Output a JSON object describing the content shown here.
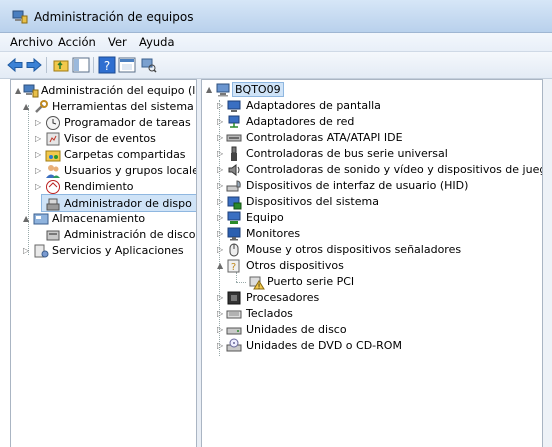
{
  "window": {
    "title": "Administración de equipos"
  },
  "menu": [
    "Archivo",
    "Acción",
    "Ver",
    "Ayuda"
  ],
  "toolbar": {
    "buttons": [
      "back-icon",
      "forward-icon",
      "up-folder-icon",
      "show-hide-tree-icon",
      "help-icon",
      "properties-icon",
      "scan-hardware-icon"
    ]
  },
  "left_tree": {
    "items": [
      {
        "label": "Administración del equipo (loc",
        "expand": "▲",
        "icon": "computer-management-icon",
        "level": 0
      },
      {
        "label": "Herramientas del sistema",
        "expand": "▲",
        "icon": "system-tools-icon",
        "level": 1
      },
      {
        "label": "Programador de tareas",
        "expand": "▷",
        "icon": "task-scheduler-icon",
        "level": 2
      },
      {
        "label": "Visor de eventos",
        "expand": "▷",
        "icon": "event-viewer-icon",
        "level": 2
      },
      {
        "label": "Carpetas compartidas",
        "expand": "▷",
        "icon": "shared-folders-icon",
        "level": 2
      },
      {
        "label": "Usuarios y grupos locale",
        "expand": "▷",
        "icon": "users-groups-icon",
        "level": 2
      },
      {
        "label": "Rendimiento",
        "expand": "▷",
        "icon": "performance-icon",
        "level": 2
      },
      {
        "label": "Administrador de dispo",
        "expand": "",
        "icon": "device-manager-icon",
        "level": 2,
        "selected": true
      },
      {
        "label": "Almacenamiento",
        "expand": "▲",
        "icon": "storage-icon",
        "level": 1
      },
      {
        "label": "Administración de disco",
        "expand": "",
        "icon": "disk-management-icon",
        "level": 2
      },
      {
        "label": "Servicios y Aplicaciones",
        "expand": "▷",
        "icon": "services-apps-icon",
        "level": 1
      }
    ]
  },
  "device_tree": {
    "root": {
      "label": "BQTO09",
      "expand": "▲",
      "icon": "computer-icon"
    },
    "items": [
      {
        "label": "Adaptadores de pantalla",
        "expand": "▷",
        "icon": "display-adapter-icon",
        "level": 1
      },
      {
        "label": "Adaptadores de red",
        "expand": "▷",
        "icon": "network-adapter-icon",
        "level": 1
      },
      {
        "label": "Controladoras ATA/ATAPI IDE",
        "expand": "▷",
        "icon": "ide-controller-icon",
        "level": 1
      },
      {
        "label": "Controladoras de bus serie universal",
        "expand": "▷",
        "icon": "usb-controller-icon",
        "level": 1
      },
      {
        "label": "Controladoras de sonido y vídeo y dispositivos de juego",
        "expand": "▷",
        "icon": "sound-controller-icon",
        "level": 1
      },
      {
        "label": "Dispositivos de interfaz de usuario (HID)",
        "expand": "▷",
        "icon": "hid-icon",
        "level": 1
      },
      {
        "label": "Dispositivos del sistema",
        "expand": "▷",
        "icon": "system-devices-icon",
        "level": 1
      },
      {
        "label": "Equipo",
        "expand": "▷",
        "icon": "computer-device-icon",
        "level": 1
      },
      {
        "label": "Monitores",
        "expand": "▷",
        "icon": "monitor-icon",
        "level": 1
      },
      {
        "label": "Mouse y otros dispositivos señaladores",
        "expand": "▷",
        "icon": "mouse-icon",
        "level": 1
      },
      {
        "label": "Otros dispositivos",
        "expand": "▲",
        "icon": "other-devices-icon",
        "level": 1
      },
      {
        "label": "Puerto serie PCI",
        "expand": "",
        "icon": "warning-device-icon",
        "level": 2
      },
      {
        "label": "Procesadores",
        "expand": "▷",
        "icon": "processor-icon",
        "level": 1
      },
      {
        "label": "Teclados",
        "expand": "▷",
        "icon": "keyboard-icon",
        "level": 1
      },
      {
        "label": "Unidades de disco",
        "expand": "▷",
        "icon": "disk-drive-icon",
        "level": 1
      },
      {
        "label": "Unidades de DVD o CD-ROM",
        "expand": "▷",
        "icon": "dvd-drive-icon",
        "level": 1
      }
    ]
  },
  "colors": {
    "title_bg": "#c7dbf1",
    "selection": "#cfe3f7",
    "pane_border": "#aab5c3"
  }
}
